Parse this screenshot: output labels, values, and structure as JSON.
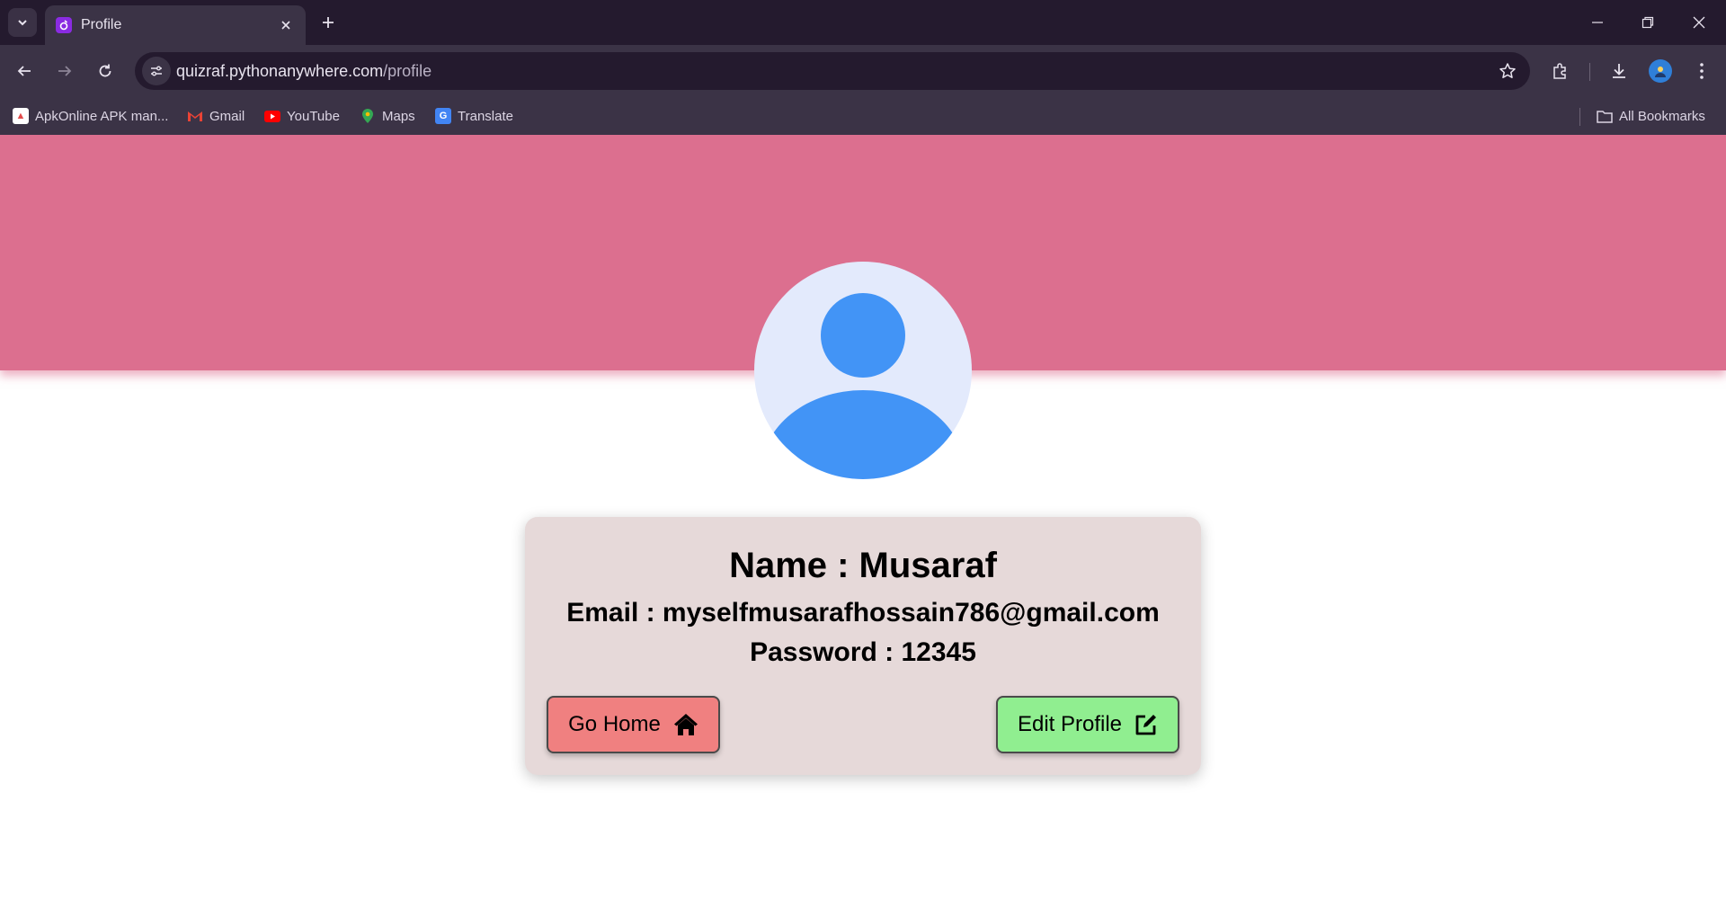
{
  "browser": {
    "tab": {
      "title": "Profile"
    },
    "address_bar": {
      "host": "quizraf.pythonanywhere.com",
      "path": "/profile"
    },
    "bookmarks": [
      {
        "label": "ApkOnline APK man...",
        "icon": "apkonline-icon"
      },
      {
        "label": "Gmail",
        "icon": "gmail-icon"
      },
      {
        "label": "YouTube",
        "icon": "youtube-icon"
      },
      {
        "label": "Maps",
        "icon": "maps-icon"
      },
      {
        "label": "Translate",
        "icon": "translate-icon"
      }
    ],
    "all_bookmarks_label": "All Bookmarks"
  },
  "profile": {
    "name_line": "Name : Musaraf",
    "email_line": "Email : myselfmusarafhossain786@gmail.com",
    "password_line": "Password : 12345",
    "go_home_label": "Go Home",
    "edit_profile_label": "Edit Profile"
  },
  "colors": {
    "banner": "#dc6f8f",
    "card": "#e6d9d9",
    "go_home_button": "#f08080",
    "edit_profile_button": "#90ee90",
    "avatar_fill": "#4294f6",
    "avatar_bg": "#e3eafc"
  }
}
